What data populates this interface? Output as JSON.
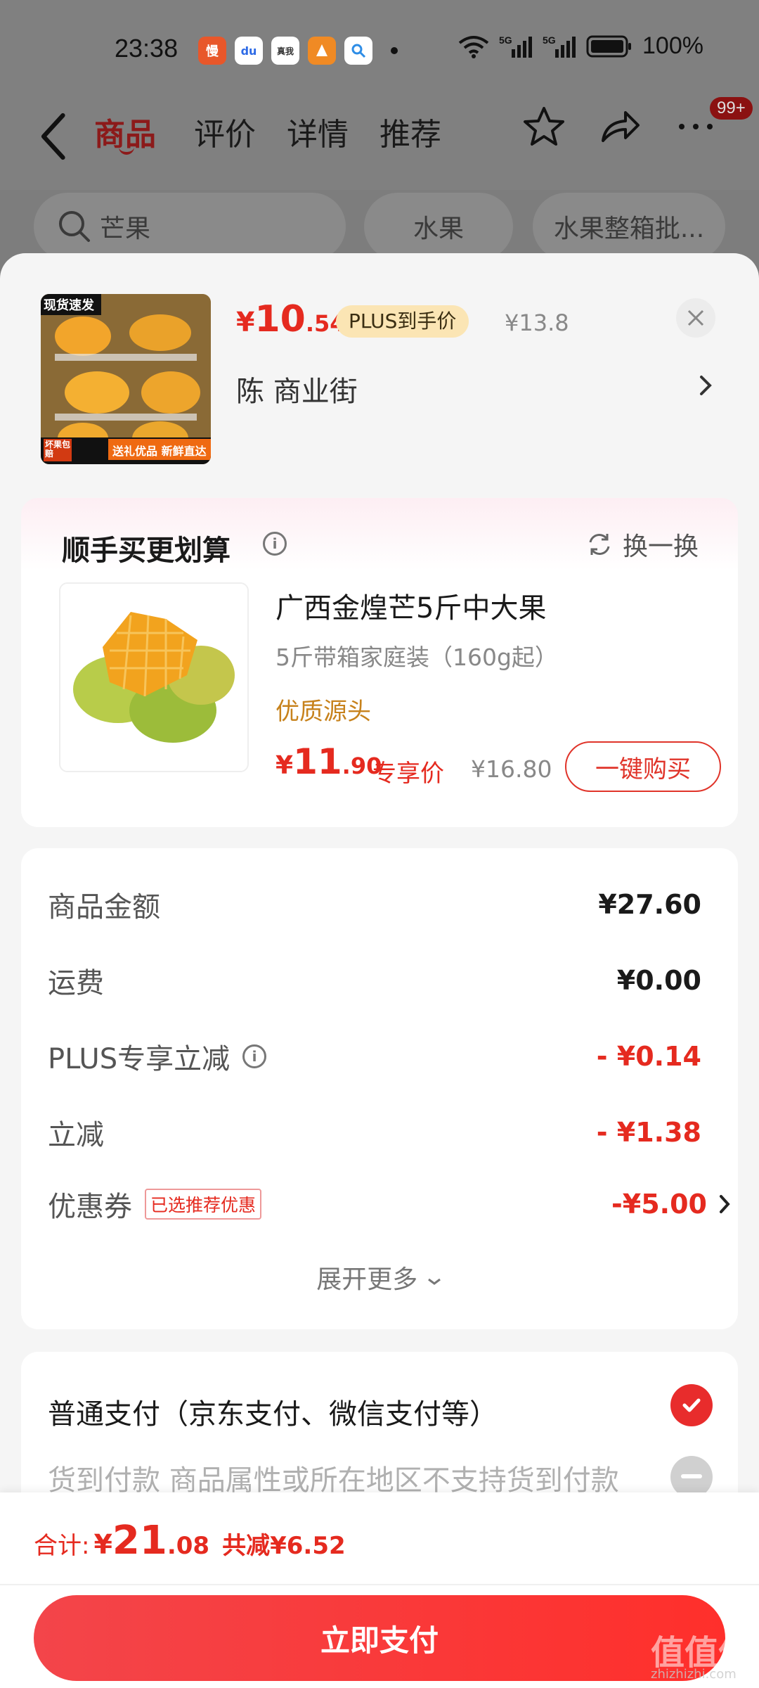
{
  "status_bar": {
    "time": "23:38",
    "battery": "100%",
    "apps": [
      {
        "label": "慢",
        "color": "#e8572a"
      },
      {
        "label": "du",
        "color": "#2e6be6"
      },
      {
        "label": "真我",
        "color": "#f2f2f2"
      },
      {
        "label": "",
        "color": "#f08a24"
      },
      {
        "label": "",
        "color": "#e9f4ff"
      }
    ]
  },
  "nav": {
    "tabs": [
      "商品",
      "评价",
      "详情",
      "推荐"
    ],
    "active_tab": 0,
    "badge": "99+"
  },
  "search_chips": [
    "芒果",
    "水果",
    "水果整箱批..."
  ],
  "product": {
    "image_caption_top": "现货速发",
    "image_caption_bottom": "送礼优品 新鲜直达",
    "image_caption_left": "坏果包赔",
    "price_yen": "¥",
    "price_int": "10",
    "price_dec": ".54",
    "plus_tag": "PLUS到手价",
    "price_orig": "¥13.8",
    "address": "陈  商业街"
  },
  "bundle": {
    "title": "顺手买更划算",
    "swap": "换一换",
    "name": "广西金煌芒5斤中大果",
    "spec": "5斤带箱家庭装（160g起）",
    "tag": "优质源头",
    "price_yen": "¥",
    "price_int": "11",
    "price_dec": ".90",
    "exclusive": "专享价",
    "price_orig": "¥16.80",
    "buy_button": "一键购买"
  },
  "summary": {
    "rows": [
      {
        "label": "商品金额",
        "value": "¥27.60"
      },
      {
        "label": "运费",
        "value": "¥0.00"
      },
      {
        "label": "PLUS专享立减",
        "value": "- ¥0.14"
      },
      {
        "label": "立减",
        "value": "- ¥1.38"
      },
      {
        "label": "优惠券",
        "value": "-¥5.00",
        "tag": "已选推荐优惠"
      }
    ],
    "expand": "展开更多"
  },
  "payment": {
    "option1": "普通支付（京东支付、微信支付等）",
    "option2": "货到付款  商品属性或所在地区不支持货到付款"
  },
  "footer": {
    "total_label": "合计:",
    "total_yen": "¥",
    "total_int": "21",
    "total_dec": ".08",
    "saved": "共减¥6.52",
    "pay_button": "立即支付"
  },
  "watermark": {
    "text": "值值值",
    "sub": "zhizhizhi.com"
  },
  "colors": {
    "accent": "#e52a1f",
    "plus_tag": "#fbe5b4",
    "origin_tag": "#c7821c"
  }
}
